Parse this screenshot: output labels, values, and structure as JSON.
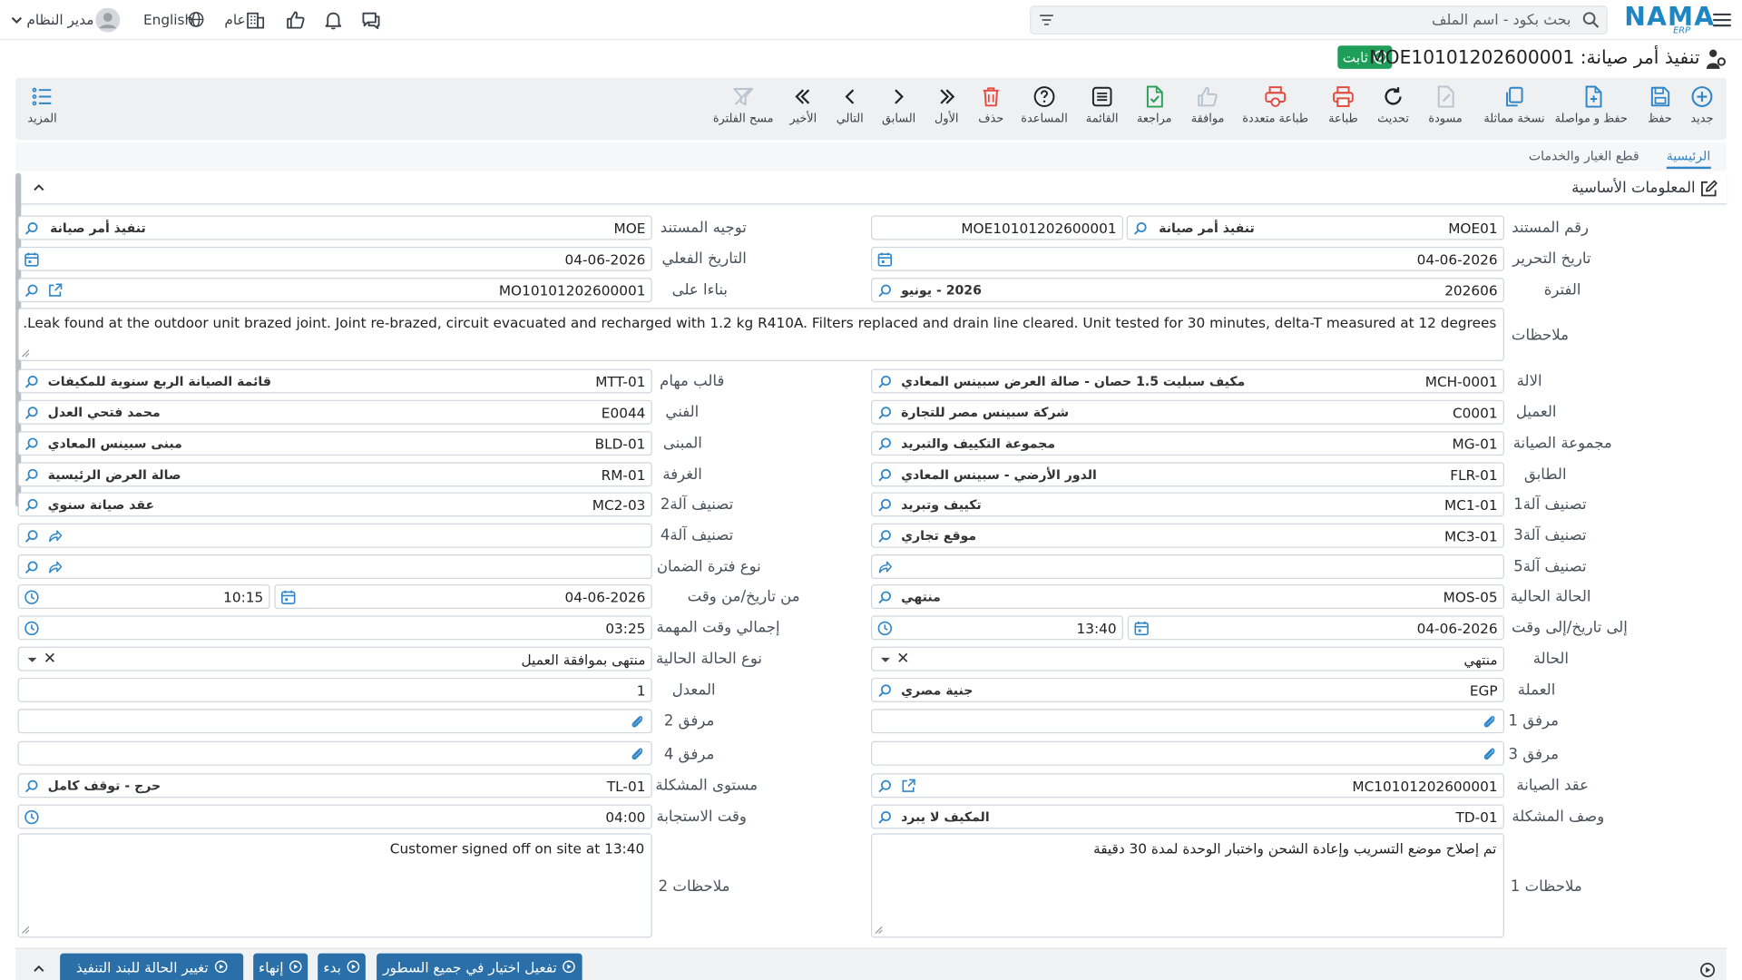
{
  "topbar": {
    "user_name": "مدير النظام",
    "language": "English",
    "scope": "عام",
    "search_placeholder": "بحث بكود - اسم الملف",
    "logo_text": "NAMA",
    "logo_sub": "ERP"
  },
  "header": {
    "title": "تنفيذ أمر صيانة: MOE10101202600001",
    "status": "ثابت"
  },
  "toolbar": {
    "new": "جديد",
    "save": "حفظ",
    "save_continue": "حفظ و مواصلة",
    "duplicate": "نسخة مماثلة",
    "draft": "مسودة",
    "refresh": "تحديث",
    "print": "طباعة",
    "multi_print": "طباعة متعددة",
    "approve": "موافقة",
    "review": "مراجعة",
    "list": "القائمة",
    "help": "المساعدة",
    "delete": "حذف",
    "first": "الأول",
    "previous": "السابق",
    "next": "التالي",
    "last": "الأخير",
    "clear_filter": "مسح الفلترة",
    "more": "المزيد"
  },
  "tabs": {
    "main": "الرئيسية",
    "parts": "قطع الغيار والخدمات"
  },
  "section": {
    "title": "المعلومات الأساسية"
  },
  "form": {
    "doc_number": {
      "label": "رقم المستند",
      "code": "MOE01",
      "name": "تنفيذ أمر صيانة",
      "number": "MOE10101202600001"
    },
    "doc_direction": {
      "label": "توجيه المستند",
      "code": "MOE",
      "name": "تنفيذ أمر صيانة"
    },
    "edit_date": {
      "label": "تاريخ التحرير",
      "value": "04-06-2026"
    },
    "actual_date": {
      "label": "التاريخ الفعلي",
      "value": "04-06-2026"
    },
    "period": {
      "label": "الفترة",
      "code": "202606",
      "name": "2026 - يونيو"
    },
    "based_on": {
      "label": "بناءا على",
      "value": "MO10101202600001"
    },
    "notes": {
      "label": "ملاحظات",
      "value": "Leak found at the outdoor unit brazed joint. Joint re-brazed, circuit evacuated and recharged with 1.2 kg R410A. Filters replaced and drain line cleared. Unit tested for 30 minutes, delta-T measured at 12 degrees."
    },
    "machine": {
      "label": "الالة",
      "code": "MCH-0001",
      "name": "مكيف سبليت 1.5 حصان - صالة العرض سبينس المعادي"
    },
    "task_template": {
      "label": "قالب مهام",
      "code": "MTT-01",
      "name": "قائمة الصيانة الربع سنوية للمكيفات"
    },
    "customer": {
      "label": "العميل",
      "code": "C0001",
      "name": "شركة سبينس مصر للتجارة"
    },
    "technician": {
      "label": "الفني",
      "code": "E0044",
      "name": "محمد فتحي العدل"
    },
    "maint_group": {
      "label": "مجموعة الصيانة",
      "code": "MG-01",
      "name": "مجموعة التكييف والتبريد"
    },
    "building": {
      "label": "المبنى",
      "code": "BLD-01",
      "name": "مبنى سبينس المعادي"
    },
    "floor": {
      "label": "الطابق",
      "code": "FLR-01",
      "name": "الدور الأرضي - سبينس المعادي"
    },
    "room": {
      "label": "الغرفة",
      "code": "RM-01",
      "name": "صالة العرض الرئيسية"
    },
    "class1": {
      "label": "تصنيف آلة1",
      "code": "MC1-01",
      "name": "تكييف وتبريد"
    },
    "class2": {
      "label": "تصنيف آلة2",
      "code": "MC2-03",
      "name": "عقد صيانة سنوي"
    },
    "class3": {
      "label": "تصنيف آلة3",
      "code": "MC3-01",
      "name": "موقع تجاري"
    },
    "class4": {
      "label": "تصنيف آلة4",
      "code": "",
      "name": ""
    },
    "class5": {
      "label": "تصنيف آلة5",
      "code": "",
      "name": ""
    },
    "warranty_type": {
      "label": "نوع فترة الضمان",
      "code": "",
      "name": ""
    },
    "current_status": {
      "label": "الحالة الحالية",
      "code": "MOS-05",
      "name": "منتهي"
    },
    "from_datetime": {
      "label": "من تاريخ/من وقت",
      "date": "04-06-2026",
      "time": "10:15"
    },
    "to_datetime": {
      "label": "إلى تاريخ/إلى وقت",
      "date": "04-06-2026",
      "time": "13:40"
    },
    "total_task_time": {
      "label": "إجمالي وقت المهمة",
      "value": "03:25"
    },
    "status": {
      "label": "الحالة",
      "value": "منتهي"
    },
    "current_status_type": {
      "label": "نوع الحالة الحالية",
      "value": "منتهى بموافقة العميل"
    },
    "currency": {
      "label": "العملة",
      "code": "EGP",
      "name": "جنية مصري"
    },
    "rate": {
      "label": "المعدل",
      "value": "1"
    },
    "attachment1": {
      "label": "مرفق 1"
    },
    "attachment2": {
      "label": "مرفق 2"
    },
    "attachment3": {
      "label": "مرفق 3"
    },
    "attachment4": {
      "label": "مرفق 4"
    },
    "maint_contract": {
      "label": "عقد الصيانة",
      "value": "MC10101202600001"
    },
    "problem_level": {
      "label": "مستوى المشكلة",
      "code": "TL-01",
      "name": "حرج - توقف كامل"
    },
    "problem_desc": {
      "label": "وصف المشكلة",
      "code": "TD-01",
      "name": "المكيف لا يبرد"
    },
    "response_time": {
      "label": "وقت الاستجابة",
      "value": "04:00"
    },
    "notes1": {
      "label": "ملاحظات 1",
      "value": "تم إصلاح موضع التسريب وإعادة الشحن واختبار الوحدة لمدة 30 دقيقة"
    },
    "notes2": {
      "label": "ملاحظات 2",
      "value": "Customer signed off on site at 13:40"
    }
  },
  "bottom": {
    "btn_apply_all": "تفعيل اختيار في جميع السطور",
    "btn_start": "بدء",
    "btn_finish": "إنهاء",
    "btn_change_status": "تغيير الحالة للبند التنفيذ"
  },
  "colors": {
    "accent": "#2f86c7",
    "status_green": "#1e9e58",
    "print_red": "#e34b3f",
    "bottom_btn": "#2a6fa8"
  }
}
